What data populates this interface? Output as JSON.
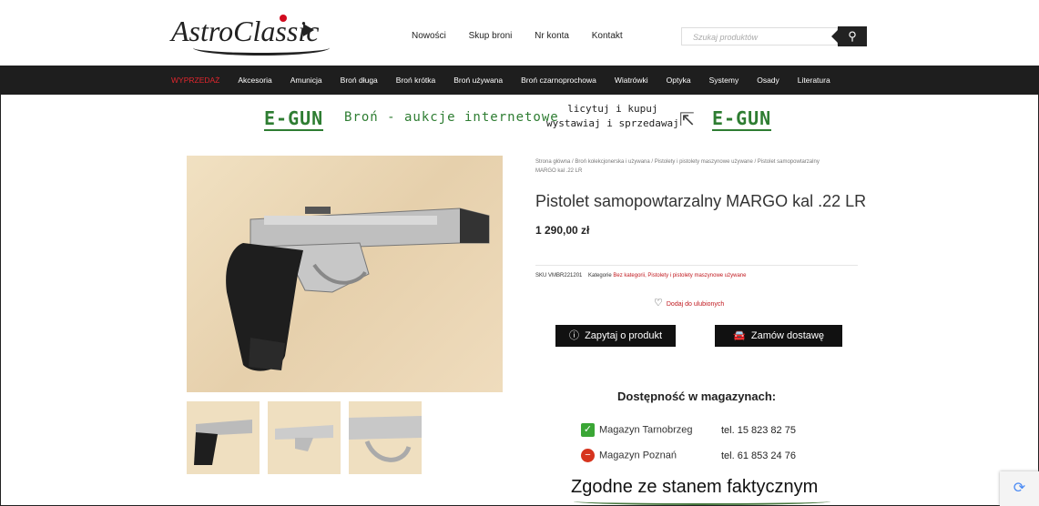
{
  "header": {
    "logo_text": "AstroClassic",
    "nav": [
      "Nowości",
      "Skup broni",
      "Nr konta",
      "Kontakt"
    ],
    "search_placeholder": "Szukaj produktów"
  },
  "categories": [
    "WYPRZEDAŻ",
    "Akcesoria",
    "Amunicja",
    "Broń długa",
    "Broń krótka",
    "Broń używana",
    "Broń czarnoprochowa",
    "Wiatrówki",
    "Optyka",
    "Systemy",
    "Osady",
    "Literatura"
  ],
  "banner": {
    "egun_left": "E-GUN",
    "tagline": "Broń - aukcje internetowe",
    "line1": "licytuj i kupuj",
    "line2": "wystawiaj i sprzedawaj",
    "egun_right": "E-GUN"
  },
  "product": {
    "breadcrumb": "Strona główna / Broń kolekcjonerska i używana / Pistolety i pistolety maszynowe używane / Pistolet samopowtarzalny MARGO kal .22 LR",
    "title": "Pistolet samopowtarzalny MARGO kal .22 LR",
    "price": "1 290,00 zł",
    "sku_label": "SKU",
    "sku": "VMBR221201",
    "category_label": "Kategorie",
    "categories": "Bez kategorii, Pistolety i pistolety maszynowe używane",
    "fav_label": "Dodaj do ulubionych",
    "ask_button": "Zapytaj o produkt",
    "order_button": "Zamów dostawę"
  },
  "availability": {
    "title": "Dostępność w magazynach:",
    "stores": [
      {
        "name": "Magazyn Tarnobrzeg",
        "tel": "tel. 15 823 82 75",
        "status": "available"
      },
      {
        "name": "Magazyn Poznań",
        "tel": "tel. 61 853 24 76",
        "status": "unavailable"
      }
    ],
    "note": "Zgodne ze stanem faktycznym"
  },
  "colors": {
    "accent_red": "#c0181e",
    "egun_green": "#2e7d32",
    "dark": "#1e1e1e"
  }
}
